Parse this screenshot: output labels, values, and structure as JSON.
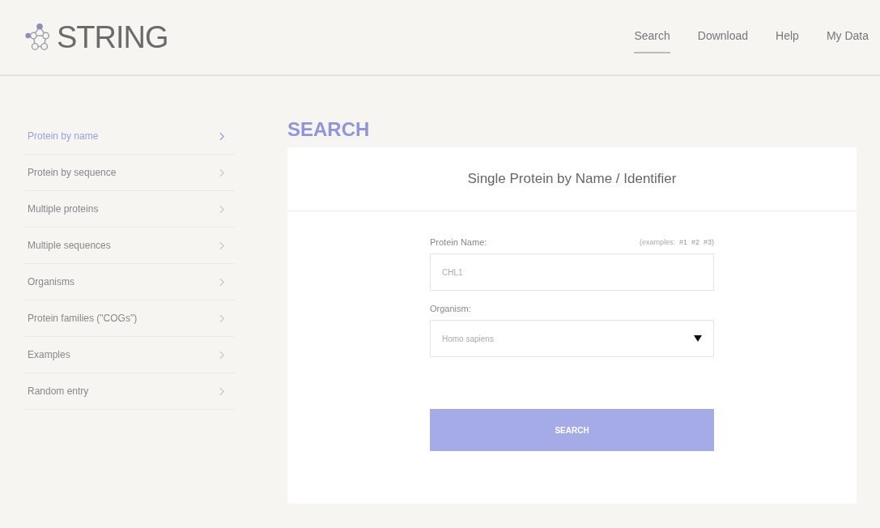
{
  "logo": {
    "text": "STRING"
  },
  "nav": [
    {
      "label": "Search",
      "selected": true
    },
    {
      "label": "Download",
      "selected": false
    },
    {
      "label": "Help",
      "selected": false
    },
    {
      "label": "My Data",
      "selected": false
    }
  ],
  "sidebar": {
    "items": [
      {
        "label": "Protein by name",
        "selected": true
      },
      {
        "label": "Protein by sequence",
        "selected": false
      },
      {
        "label": "Multiple proteins",
        "selected": false
      },
      {
        "label": "Multiple sequences",
        "selected": false
      },
      {
        "label": "Organisms",
        "selected": false
      },
      {
        "label": "Protein families (\"COGs\")",
        "selected": false
      },
      {
        "label": "Examples",
        "selected": false
      },
      {
        "label": "Random entry",
        "selected": false
      }
    ]
  },
  "heading": "SEARCH",
  "card": {
    "title": "Single Protein by Name / Identifier",
    "protein_label": "Protein Name:",
    "examples": {
      "label": "(examples:",
      "links": [
        "#1",
        "#2",
        "#3)"
      ]
    },
    "protein_value": "CHL1",
    "organism_label": "Organism:",
    "organism_value": "Homo sapiens",
    "button": "SEARCH"
  }
}
